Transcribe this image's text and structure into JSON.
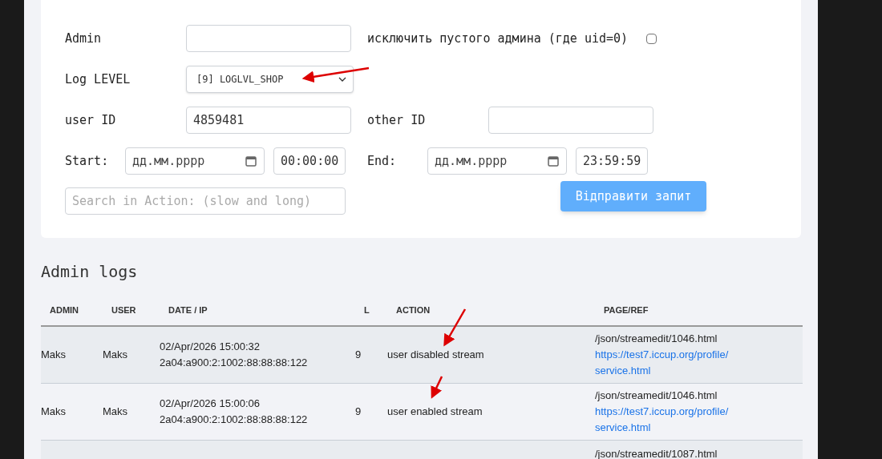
{
  "search_form": {
    "admin": {
      "label": "Admin"
    },
    "exclude_empty_admin": {
      "label": "исключить пустого админа (где uid=0)",
      "checked": false
    },
    "log_level": {
      "label": "Log LEVEL",
      "value": "[9] LOGLVL_SHOP"
    },
    "user_id": {
      "label": "user ID",
      "value": "4859481"
    },
    "other_id": {
      "label": "other ID"
    },
    "start": {
      "label": "Start:",
      "date_placeholder": "дд.мм.рррр",
      "time": "00:00:00"
    },
    "end": {
      "label": "End:",
      "date_placeholder": "дд.мм.рррр",
      "time": "23:59:59"
    },
    "action_search": {
      "placeholder": "Search in Action: (slow and long)"
    },
    "submit": "Відправити запит"
  },
  "logs": {
    "title": "Admin logs",
    "columns": [
      "ADMIN",
      "USER",
      "DATE / IP",
      "L",
      "ACTION",
      "PAGE/REF"
    ],
    "rows": [
      {
        "admin": "Maks",
        "user": "Maks",
        "date": "02/Apr/2026 15:00:32",
        "ip": "2a04:a900:2:1002:88:88:88:122",
        "level": "9",
        "action": "user disabled stream",
        "page": "/json/streamedit/1046.html",
        "ref": "https://test7.iccup.org/profile/service.html"
      },
      {
        "admin": "Maks",
        "user": "Maks",
        "date": "02/Apr/2026 15:00:06",
        "ip": "2a04:a900:2:1002:88:88:88:122",
        "level": "9",
        "action": "user enabled stream",
        "page": "/json/streamedit/1046.html",
        "ref": "https://test7.iccup.org/profile/service.html"
      },
      {
        "page": "/json/streamedit/1087.html"
      }
    ]
  }
}
